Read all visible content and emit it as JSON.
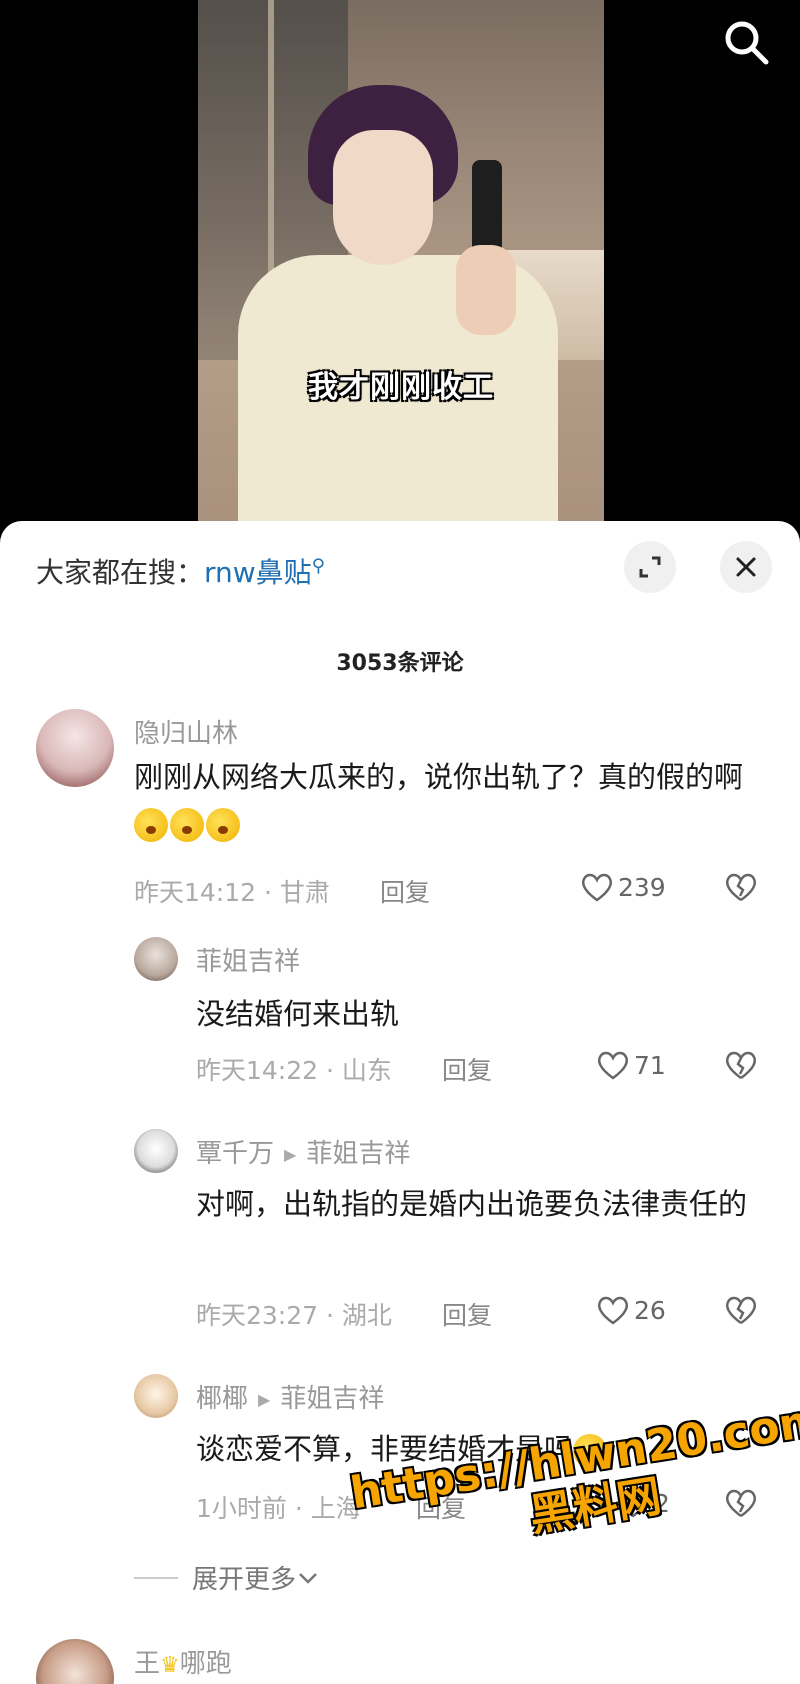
{
  "video": {
    "subtitle": "我才刚刚收工"
  },
  "hot_search": {
    "prefix": "大家都在搜：",
    "term": "rnw鼻贴"
  },
  "comment_count": "3053条评论",
  "comments": [
    {
      "user": "隐归山林",
      "text": "刚刚从网络大瓜来的，说你出轨了？真的假的啊",
      "meta": "昨天14:12 · 甘肃",
      "reply": "回复",
      "likes": "239"
    },
    {
      "user": "菲姐吉祥",
      "text": "没结婚何来出轨",
      "meta": "昨天14:22 · 山东",
      "reply": "回复",
      "likes": "71"
    },
    {
      "user": "覃千万",
      "reply_to": "菲姐吉祥",
      "text": "对啊，出轨指的是婚内出诡要负法律责任的",
      "meta": "昨天23:27 · 湖北",
      "reply": "回复",
      "likes": "26"
    },
    {
      "user": "椰椰",
      "reply_to": "菲姐吉祥",
      "text": "谈恋爱不算，非要结婚才是吗",
      "meta": "1小时前 · 上海",
      "reply": "回复",
      "likes": "2"
    },
    {
      "user": "王",
      "user_suffix": "哪跑"
    }
  ],
  "expand_more": "展开更多",
  "watermark": {
    "line1": "https://hlwn20.com",
    "line2": "黑料网"
  }
}
